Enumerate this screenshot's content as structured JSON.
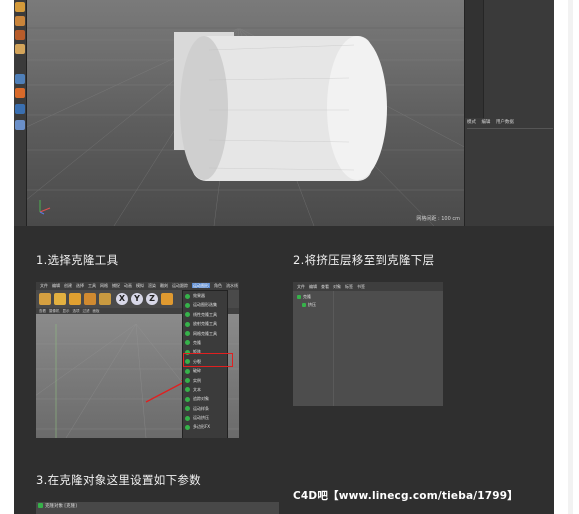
{
  "viewport": {
    "status_text": "网格间距 : 100 cm",
    "right_tabs": [
      "模式",
      "编辑",
      "用户数据"
    ]
  },
  "steps": [
    {
      "title": "1.选择克隆工具",
      "menu": [
        "文件",
        "编辑",
        "创建",
        "选择",
        "工具",
        "网格",
        "捕捉",
        "动画",
        "模拟",
        "渲染",
        "雕刻",
        "运动跟踪",
        "运动图形",
        "角色",
        "流水线",
        "插件",
        "脚本",
        "窗口",
        "帮助"
      ],
      "toolbar_letters": [
        "X",
        "Y",
        "Z"
      ],
      "subbar": [
        "查看",
        "摄像机",
        "显示",
        "选项",
        "过滤",
        "面板"
      ],
      "dropdown_items": [
        "效果器",
        "运动图形选集",
        "线性克隆工具",
        "放射克隆工具",
        "网格克隆工具",
        "克隆",
        "矩阵",
        "分裂",
        "破碎",
        "实例",
        "文本",
        "追踪对象",
        "运动样条",
        "运动挤压",
        "多边形FX"
      ],
      "dropdown_selected": "克隆"
    },
    {
      "title": "2.将挤压层移至到克隆下层",
      "menu": [
        "文件",
        "编辑",
        "查看",
        "对象",
        "标签",
        "书签"
      ],
      "objects": [
        "克隆",
        "挤压"
      ]
    },
    {
      "title": "3.在克隆对象这里设置如下参数",
      "panel_header": "克隆对象 [克隆]"
    }
  ],
  "watermark": "C4D吧【www.linecg.com/tieba/1799】",
  "colors": {
    "panel_bg": "#2f2f2f",
    "accent_red": "#e02020",
    "accent_green": "#36b24a"
  }
}
